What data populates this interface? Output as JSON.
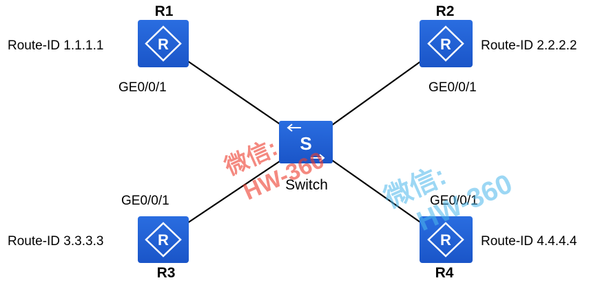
{
  "routers": {
    "r1": {
      "name": "R1",
      "route_id": "Route-ID 1.1.1.1",
      "port": "GE0/0/1",
      "icon": "router-icon"
    },
    "r2": {
      "name": "R2",
      "route_id": "Route-ID 2.2.2.2",
      "port": "GE0/0/1",
      "icon": "router-icon"
    },
    "r3": {
      "name": "R3",
      "route_id": "Route-ID 3.3.3.3",
      "port": "GE0/0/1",
      "icon": "router-icon"
    },
    "r4": {
      "name": "R4",
      "route_id": "Route-ID 4.4.4.4",
      "port": "GE0/0/1",
      "icon": "router-icon"
    }
  },
  "switch": {
    "label": "Switch",
    "glyph": "S",
    "icon": "switch-icon"
  },
  "watermarks": {
    "red": {
      "line1": "微信:",
      "line2": "HW-360"
    },
    "blue": {
      "line1": "微信:",
      "line2": "HW-360"
    }
  },
  "colors": {
    "device_blue": "#1f5fd6",
    "link": "#000000",
    "watermark_red": "#ee3b2c",
    "watermark_blue": "#4db8ec"
  }
}
